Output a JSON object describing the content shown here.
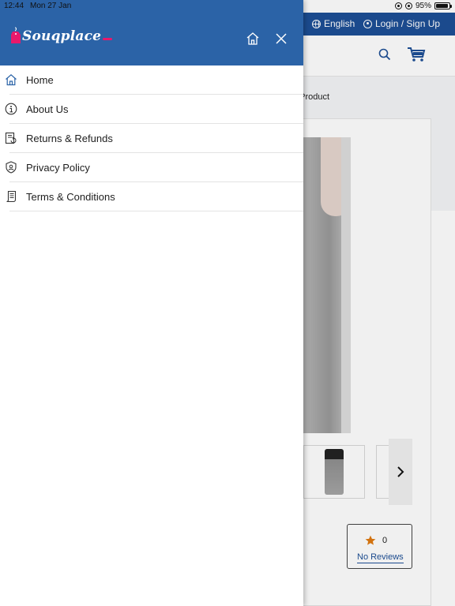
{
  "status_bar": {
    "time": "12:44",
    "date": "Mon 27 Jan",
    "battery_text": "95%",
    "battery_level": 0.95
  },
  "topbar": {
    "language": "English",
    "login": "Login / Sign Up",
    "color": "#1d4f96"
  },
  "page": {
    "breadcrumb_fragment": "g Product",
    "reviews": {
      "count": "0",
      "link_label": "No Reviews"
    }
  },
  "drawer": {
    "logo_text": "Souqplace",
    "header_color": "#2b63a7",
    "accent_color": "#e8196b",
    "home_icon": "home-icon",
    "close_icon": "close-icon",
    "items": [
      {
        "label": "Home",
        "icon": "home-icon"
      },
      {
        "label": "About Us",
        "icon": "info-icon"
      },
      {
        "label": "Returns & Refunds",
        "icon": "returns-icon"
      },
      {
        "label": "Privacy Policy",
        "icon": "shield-icon"
      },
      {
        "label": "Terms & Conditions",
        "icon": "scroll-icon"
      }
    ]
  }
}
